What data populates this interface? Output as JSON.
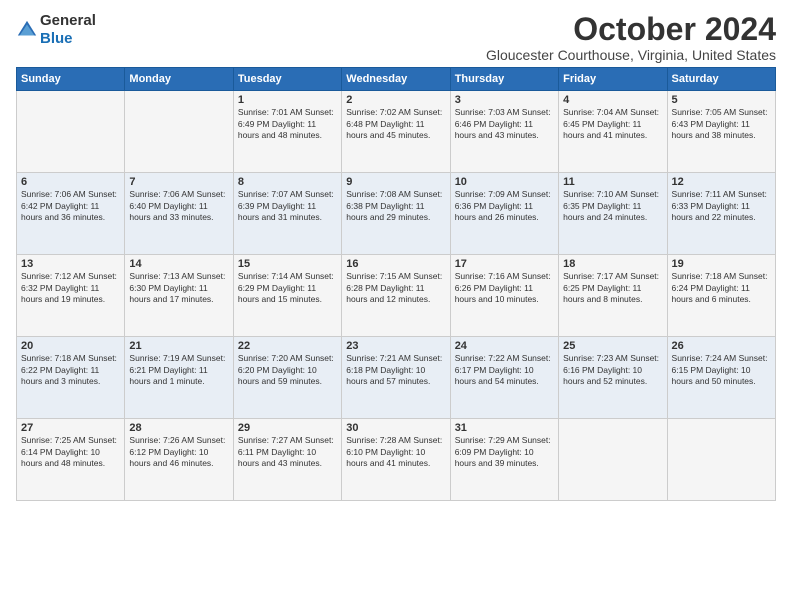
{
  "header": {
    "logo_general": "General",
    "logo_blue": "Blue",
    "month_title": "October 2024",
    "subtitle": "Gloucester Courthouse, Virginia, United States"
  },
  "days_of_week": [
    "Sunday",
    "Monday",
    "Tuesday",
    "Wednesday",
    "Thursday",
    "Friday",
    "Saturday"
  ],
  "weeks": [
    [
      {
        "day": "",
        "info": ""
      },
      {
        "day": "",
        "info": ""
      },
      {
        "day": "1",
        "info": "Sunrise: 7:01 AM\nSunset: 6:49 PM\nDaylight: 11 hours and 48 minutes."
      },
      {
        "day": "2",
        "info": "Sunrise: 7:02 AM\nSunset: 6:48 PM\nDaylight: 11 hours and 45 minutes."
      },
      {
        "day": "3",
        "info": "Sunrise: 7:03 AM\nSunset: 6:46 PM\nDaylight: 11 hours and 43 minutes."
      },
      {
        "day": "4",
        "info": "Sunrise: 7:04 AM\nSunset: 6:45 PM\nDaylight: 11 hours and 41 minutes."
      },
      {
        "day": "5",
        "info": "Sunrise: 7:05 AM\nSunset: 6:43 PM\nDaylight: 11 hours and 38 minutes."
      }
    ],
    [
      {
        "day": "6",
        "info": "Sunrise: 7:06 AM\nSunset: 6:42 PM\nDaylight: 11 hours and 36 minutes."
      },
      {
        "day": "7",
        "info": "Sunrise: 7:06 AM\nSunset: 6:40 PM\nDaylight: 11 hours and 33 minutes."
      },
      {
        "day": "8",
        "info": "Sunrise: 7:07 AM\nSunset: 6:39 PM\nDaylight: 11 hours and 31 minutes."
      },
      {
        "day": "9",
        "info": "Sunrise: 7:08 AM\nSunset: 6:38 PM\nDaylight: 11 hours and 29 minutes."
      },
      {
        "day": "10",
        "info": "Sunrise: 7:09 AM\nSunset: 6:36 PM\nDaylight: 11 hours and 26 minutes."
      },
      {
        "day": "11",
        "info": "Sunrise: 7:10 AM\nSunset: 6:35 PM\nDaylight: 11 hours and 24 minutes."
      },
      {
        "day": "12",
        "info": "Sunrise: 7:11 AM\nSunset: 6:33 PM\nDaylight: 11 hours and 22 minutes."
      }
    ],
    [
      {
        "day": "13",
        "info": "Sunrise: 7:12 AM\nSunset: 6:32 PM\nDaylight: 11 hours and 19 minutes."
      },
      {
        "day": "14",
        "info": "Sunrise: 7:13 AM\nSunset: 6:30 PM\nDaylight: 11 hours and 17 minutes."
      },
      {
        "day": "15",
        "info": "Sunrise: 7:14 AM\nSunset: 6:29 PM\nDaylight: 11 hours and 15 minutes."
      },
      {
        "day": "16",
        "info": "Sunrise: 7:15 AM\nSunset: 6:28 PM\nDaylight: 11 hours and 12 minutes."
      },
      {
        "day": "17",
        "info": "Sunrise: 7:16 AM\nSunset: 6:26 PM\nDaylight: 11 hours and 10 minutes."
      },
      {
        "day": "18",
        "info": "Sunrise: 7:17 AM\nSunset: 6:25 PM\nDaylight: 11 hours and 8 minutes."
      },
      {
        "day": "19",
        "info": "Sunrise: 7:18 AM\nSunset: 6:24 PM\nDaylight: 11 hours and 6 minutes."
      }
    ],
    [
      {
        "day": "20",
        "info": "Sunrise: 7:18 AM\nSunset: 6:22 PM\nDaylight: 11 hours and 3 minutes."
      },
      {
        "day": "21",
        "info": "Sunrise: 7:19 AM\nSunset: 6:21 PM\nDaylight: 11 hours and 1 minute."
      },
      {
        "day": "22",
        "info": "Sunrise: 7:20 AM\nSunset: 6:20 PM\nDaylight: 10 hours and 59 minutes."
      },
      {
        "day": "23",
        "info": "Sunrise: 7:21 AM\nSunset: 6:18 PM\nDaylight: 10 hours and 57 minutes."
      },
      {
        "day": "24",
        "info": "Sunrise: 7:22 AM\nSunset: 6:17 PM\nDaylight: 10 hours and 54 minutes."
      },
      {
        "day": "25",
        "info": "Sunrise: 7:23 AM\nSunset: 6:16 PM\nDaylight: 10 hours and 52 minutes."
      },
      {
        "day": "26",
        "info": "Sunrise: 7:24 AM\nSunset: 6:15 PM\nDaylight: 10 hours and 50 minutes."
      }
    ],
    [
      {
        "day": "27",
        "info": "Sunrise: 7:25 AM\nSunset: 6:14 PM\nDaylight: 10 hours and 48 minutes."
      },
      {
        "day": "28",
        "info": "Sunrise: 7:26 AM\nSunset: 6:12 PM\nDaylight: 10 hours and 46 minutes."
      },
      {
        "day": "29",
        "info": "Sunrise: 7:27 AM\nSunset: 6:11 PM\nDaylight: 10 hours and 43 minutes."
      },
      {
        "day": "30",
        "info": "Sunrise: 7:28 AM\nSunset: 6:10 PM\nDaylight: 10 hours and 41 minutes."
      },
      {
        "day": "31",
        "info": "Sunrise: 7:29 AM\nSunset: 6:09 PM\nDaylight: 10 hours and 39 minutes."
      },
      {
        "day": "",
        "info": ""
      },
      {
        "day": "",
        "info": ""
      }
    ]
  ]
}
